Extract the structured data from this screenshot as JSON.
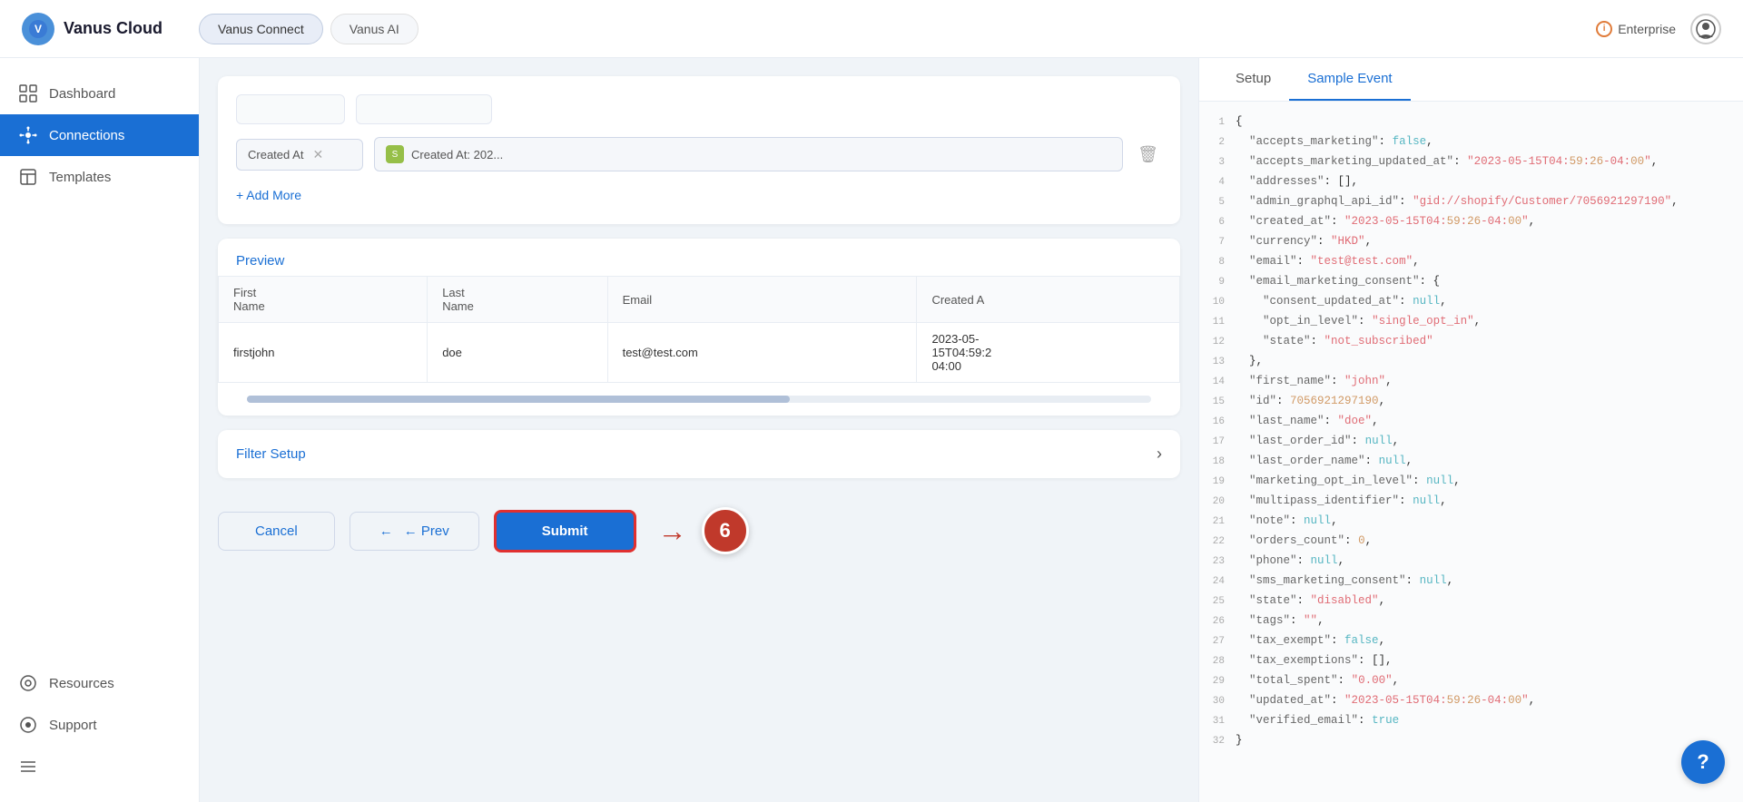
{
  "app": {
    "name": "Vanus Cloud",
    "logo_char": "V"
  },
  "topnav": {
    "tabs": [
      {
        "id": "connect",
        "label": "Vanus Connect",
        "active": true
      },
      {
        "id": "ai",
        "label": "Vanus AI",
        "active": false
      }
    ],
    "enterprise_label": "Enterprise",
    "enterprise_icon": "i"
  },
  "sidebar": {
    "items": [
      {
        "id": "dashboard",
        "label": "Dashboard",
        "icon": "▦",
        "active": false
      },
      {
        "id": "connections",
        "label": "Connections",
        "icon": "⟳",
        "active": true
      },
      {
        "id": "templates",
        "label": "Templates",
        "icon": "⊞",
        "active": false
      },
      {
        "id": "resources",
        "label": "Resources",
        "icon": "◉",
        "active": false
      },
      {
        "id": "support",
        "label": "Support",
        "icon": "⊙",
        "active": false
      },
      {
        "id": "menu",
        "label": "",
        "icon": "☰",
        "active": false
      }
    ]
  },
  "form": {
    "field_rows": [
      {
        "field_label": "Created At",
        "field_value_icon": "S",
        "field_value_text": "Created At: 202...",
        "show_delete": true
      }
    ],
    "add_more_label": "+ Add More"
  },
  "preview": {
    "label": "Preview",
    "columns": [
      "First Name",
      "Last Name",
      "Email",
      "Created A"
    ],
    "rows": [
      {
        "first_name": "firstjohn",
        "last_name": "doe",
        "email": "test@test.com",
        "created_at": "2023-05-15T04:59:2 04:00"
      }
    ]
  },
  "filter_setup": {
    "label": "Filter Setup",
    "chevron": "›"
  },
  "buttons": {
    "cancel": "Cancel",
    "prev": "← Prev",
    "submit": "Submit",
    "step_number": "6"
  },
  "right_panel": {
    "tabs": [
      {
        "id": "setup",
        "label": "Setup",
        "active": false
      },
      {
        "id": "sample_event",
        "label": "Sample Event",
        "active": true
      }
    ],
    "code_lines": [
      {
        "num": 1,
        "text": "{"
      },
      {
        "num": 2,
        "text": "  \"accepts_marketing\": false,"
      },
      {
        "num": 3,
        "text": "  \"accepts_marketing_updated_at\": \"2023-05-15T04:59:26-04:00\","
      },
      {
        "num": 4,
        "text": "  \"addresses\": [],"
      },
      {
        "num": 5,
        "text": "  \"admin_graphql_api_id\": \"gid://shopify/Customer/7056921297190\","
      },
      {
        "num": 6,
        "text": "  \"created_at\": \"2023-05-15T04:59:26-04:00\","
      },
      {
        "num": 7,
        "text": "  \"currency\": \"HKD\","
      },
      {
        "num": 8,
        "text": "  \"email\": \"test@test.com\","
      },
      {
        "num": 9,
        "text": "  \"email_marketing_consent\": {"
      },
      {
        "num": 10,
        "text": "    \"consent_updated_at\": null,"
      },
      {
        "num": 11,
        "text": "    \"opt_in_level\": \"single_opt_in\","
      },
      {
        "num": 12,
        "text": "    \"state\": \"not_subscribed\""
      },
      {
        "num": 13,
        "text": "  },"
      },
      {
        "num": 14,
        "text": "  \"first_name\": \"john\","
      },
      {
        "num": 15,
        "text": "  \"id\": 7056921297190,"
      },
      {
        "num": 16,
        "text": "  \"last_name\": \"doe\","
      },
      {
        "num": 17,
        "text": "  \"last_order_id\": null,"
      },
      {
        "num": 18,
        "text": "  \"last_order_name\": null,"
      },
      {
        "num": 19,
        "text": "  \"marketing_opt_in_level\": null,"
      },
      {
        "num": 20,
        "text": "  \"multipass_identifier\": null,"
      },
      {
        "num": 21,
        "text": "  \"note\": null,"
      },
      {
        "num": 22,
        "text": "  \"orders_count\": 0,"
      },
      {
        "num": 23,
        "text": "  \"phone\": null,"
      },
      {
        "num": 24,
        "text": "  \"sms_marketing_consent\": null,"
      },
      {
        "num": 25,
        "text": "  \"state\": \"disabled\","
      },
      {
        "num": 26,
        "text": "  \"tags\": \"\","
      },
      {
        "num": 27,
        "text": "  \"tax_exempt\": false,"
      },
      {
        "num": 28,
        "text": "  \"tax_exemptions\": [],"
      },
      {
        "num": 29,
        "text": "  \"total_spent\": \"0.00\","
      },
      {
        "num": 30,
        "text": "  \"updated_at\": \"2023-05-15T04:59:26-04:00\","
      },
      {
        "num": 31,
        "text": "  \"verified_email\": true"
      },
      {
        "num": 32,
        "text": "}"
      }
    ]
  }
}
